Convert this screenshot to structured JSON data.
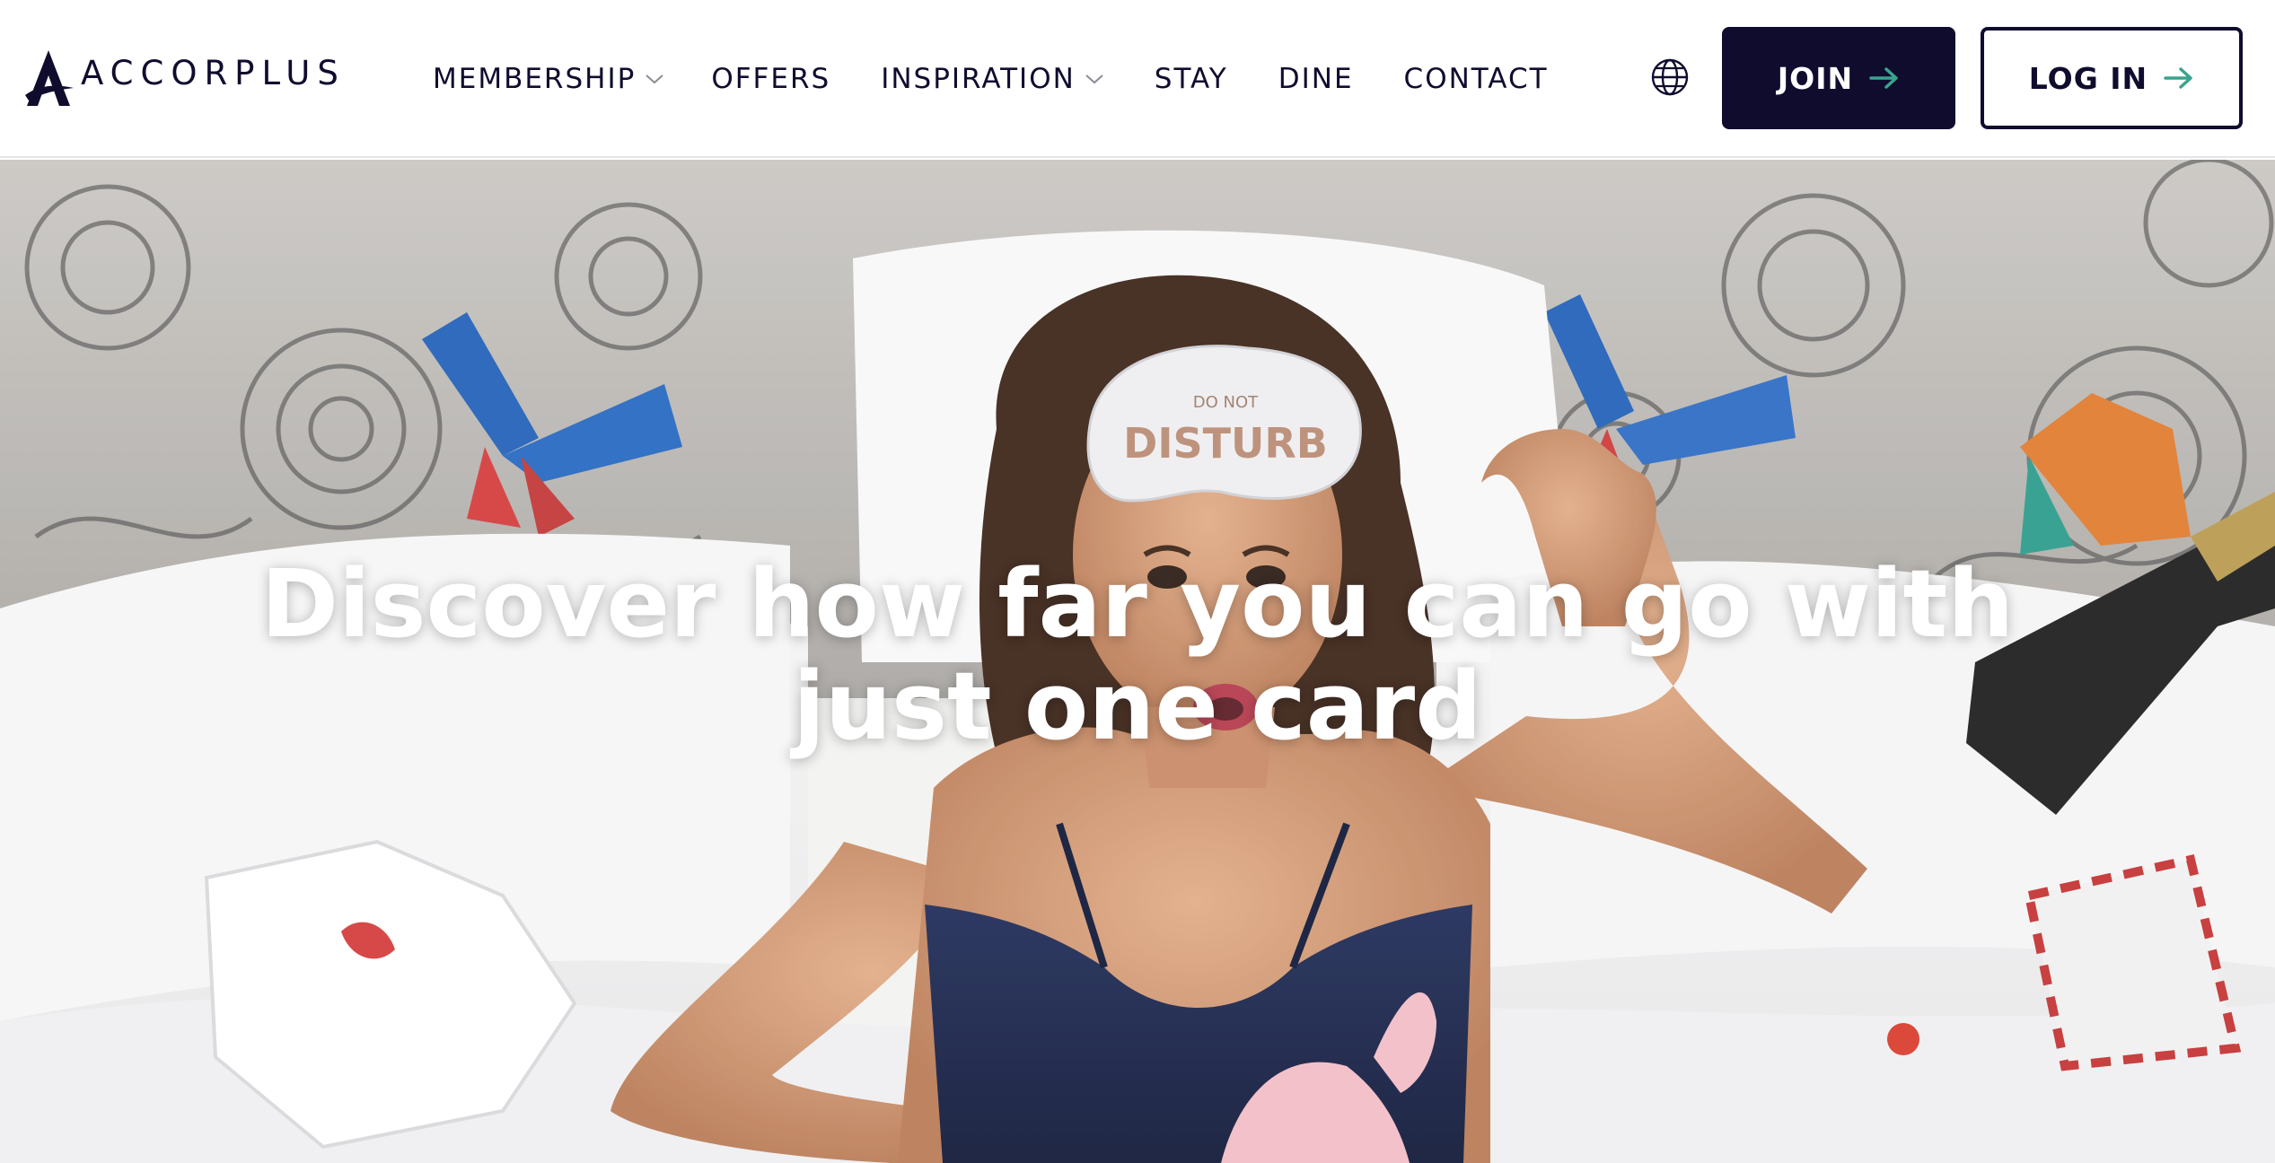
{
  "brand": {
    "name": "ACCORPLUS",
    "logo_icon": "accor-logo-icon"
  },
  "nav": {
    "items": [
      {
        "label": "MEMBERSHIP",
        "has_dropdown": true
      },
      {
        "label": "OFFERS",
        "has_dropdown": false
      },
      {
        "label": "INSPIRATION",
        "has_dropdown": true
      },
      {
        "label": "STAY",
        "has_dropdown": false
      },
      {
        "label": "DINE",
        "has_dropdown": false
      },
      {
        "label": "CONTACT",
        "has_dropdown": false
      }
    ],
    "language_icon": "globe-icon"
  },
  "actions": {
    "join_label": "JOIN",
    "login_label": "LOG IN",
    "arrow_icon": "arrow-right-icon",
    "arrow_color": "#3aa38e"
  },
  "hero": {
    "title": "Discover how far you can go with just one card",
    "image_description_icon": "hero-photo",
    "mask_text_line1": "DO NOT",
    "mask_text_line2": "DISTURB"
  },
  "colors": {
    "brand_navy": "#0f0c2e",
    "accent_teal": "#3aa38e",
    "header_bg": "#ffffff"
  }
}
